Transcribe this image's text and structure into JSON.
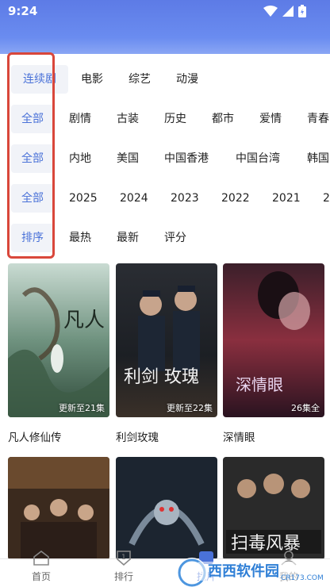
{
  "status_bar": {
    "time": "9:24"
  },
  "filters": {
    "rows": [
      {
        "selected": "连续剧",
        "options": [
          "电影",
          "综艺",
          "动漫"
        ]
      },
      {
        "selected": "全部",
        "options": [
          "剧情",
          "古装",
          "历史",
          "都市",
          "爱情",
          "青春"
        ]
      },
      {
        "selected": "全部",
        "options": [
          "内地",
          "美国",
          "中国香港",
          "中国台湾",
          "韩国"
        ]
      },
      {
        "selected": "全部",
        "options": [
          "2025",
          "2024",
          "2023",
          "2022",
          "2021",
          "2"
        ]
      },
      {
        "selected": "排序",
        "options": [
          "最热",
          "最新",
          "评分"
        ]
      }
    ]
  },
  "cards": [
    {
      "title": "凡人修仙传",
      "badge": "更新至21集"
    },
    {
      "title": "利剑玫瑰",
      "badge": "更新至22集"
    },
    {
      "title": "深情眼",
      "badge": "26集全"
    }
  ],
  "tabbar": {
    "tabs": [
      {
        "label": "首页"
      },
      {
        "label": "排行"
      },
      {
        "label": "找片"
      },
      {
        "label": "我的"
      }
    ]
  },
  "watermark": {
    "text": "西西软件园",
    "domain": "CR173.COM"
  },
  "colors": {
    "accent": "#4a72d8",
    "highlight_frame": "#d9473b",
    "header": "#6a8cf0"
  }
}
